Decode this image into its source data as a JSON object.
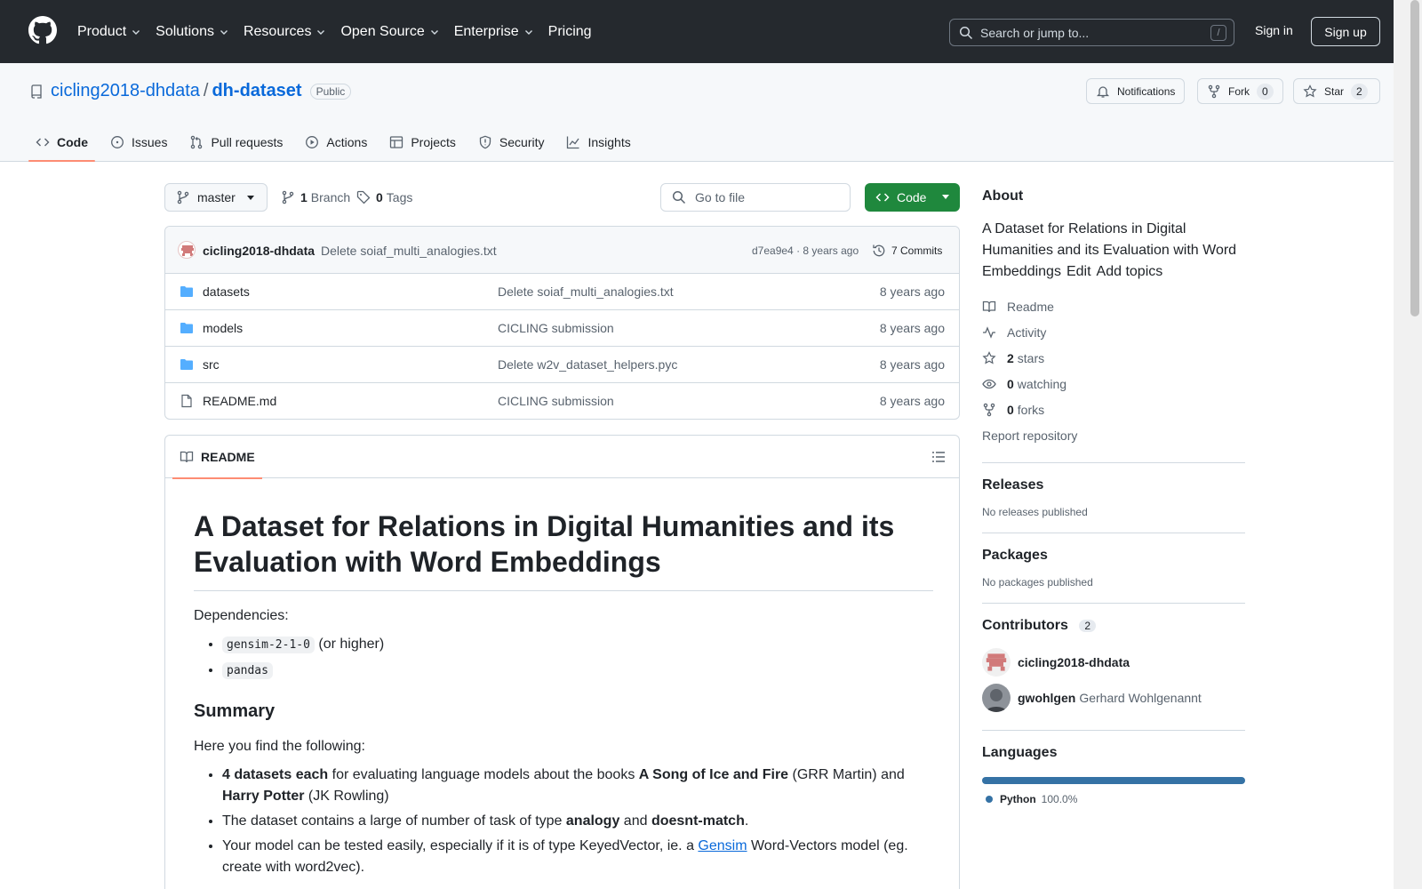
{
  "header": {
    "nav": [
      "Product",
      "Solutions",
      "Resources",
      "Open Source",
      "Enterprise",
      "Pricing"
    ],
    "search_placeholder": "Search or jump to...",
    "search_shortcut": "/",
    "sign_in": "Sign in",
    "sign_up": "Sign up"
  },
  "repo": {
    "owner": "cicling2018-dhdata",
    "separator": "/",
    "name": "dh-dataset",
    "visibility": "Public",
    "notifications_label": "Notifications",
    "fork_label": "Fork",
    "fork_count": "0",
    "star_label": "Star",
    "star_count": "2"
  },
  "tabs": [
    "Code",
    "Issues",
    "Pull requests",
    "Actions",
    "Projects",
    "Security",
    "Insights"
  ],
  "filenav": {
    "branch": "master",
    "branch_count": "1",
    "branch_label": "Branch",
    "tag_count": "0",
    "tag_label": "Tags",
    "gofile_placeholder": "Go to file",
    "code_button": "Code"
  },
  "latest_commit": {
    "author": "cicling2018-dhdata",
    "message": "Delete soiaf_multi_analogies.txt",
    "hash": "d7ea9e4",
    "dot": "·",
    "time": "8 years ago",
    "commits": "7 Commits"
  },
  "files": [
    {
      "name": "datasets",
      "type": "dir",
      "message": "Delete soiaf_multi_analogies.txt",
      "date": "8 years ago"
    },
    {
      "name": "models",
      "type": "dir",
      "message": "CICLING submission",
      "date": "8 years ago"
    },
    {
      "name": "src",
      "type": "dir",
      "message": "Delete w2v_dataset_helpers.pyc",
      "date": "8 years ago"
    },
    {
      "name": "README.md",
      "type": "file",
      "message": "CICLING submission",
      "date": "8 years ago"
    }
  ],
  "readme": {
    "tab": "README",
    "title": "A Dataset for Relations in Digital Humanities and its Evaluation with Word Embeddings",
    "dependencies_label": "Dependencies:",
    "dep1_code": "gensim-2-1-0",
    "dep1_suffix": " (or higher)",
    "dep2_code": "pandas",
    "summary_heading": "Summary",
    "summary_intro": "Here you find the following:",
    "b1_bold": "4 datasets each",
    "b1_t1": " for evaluating language models about the books ",
    "b1_bold2": "A Song of Ice and Fire",
    "b1_t2": " (GRR Martin) and ",
    "b1_bold3": "Harry Potter",
    "b1_t3": " (JK Rowling)",
    "b2_t1": "The dataset contains a large of number of task of type ",
    "b2_bold": "analogy",
    "b2_t2": " and ",
    "b2_bold2": "doesnt-match",
    "b2_t3": ".",
    "b3_t1": "Your model can be tested easily, especially if it is of type KeyedVector, ie. a ",
    "b3_link": "Gensim",
    "b3_t2": " Word-Vectors model (eg. create with word2vec)."
  },
  "sidebar": {
    "about_heading": "About",
    "description": "A Dataset for Relations in Digital Humanities and its Evaluation with Word Embeddings",
    "edit": "Edit",
    "add_topics": "Add topics",
    "readme": "Readme",
    "activity": "Activity",
    "stars_count": "2",
    "stars_label": "stars",
    "watching_count": "0",
    "watching_label": "watching",
    "forks_count": "0",
    "forks_label": "forks",
    "report": "Report repository",
    "releases_heading": "Releases",
    "releases_text": "No releases published",
    "packages_heading": "Packages",
    "packages_text": "No packages published",
    "contributors_heading": "Contributors",
    "contributors_count": "2",
    "contributors": [
      {
        "login": "cicling2018-dhdata",
        "name": ""
      },
      {
        "login": "gwohlgen",
        "name": "Gerhard Wohlgenannt"
      }
    ],
    "languages_heading": "Languages",
    "language": "Python",
    "language_percent": "100.0%",
    "language_color": "#3572A5"
  }
}
